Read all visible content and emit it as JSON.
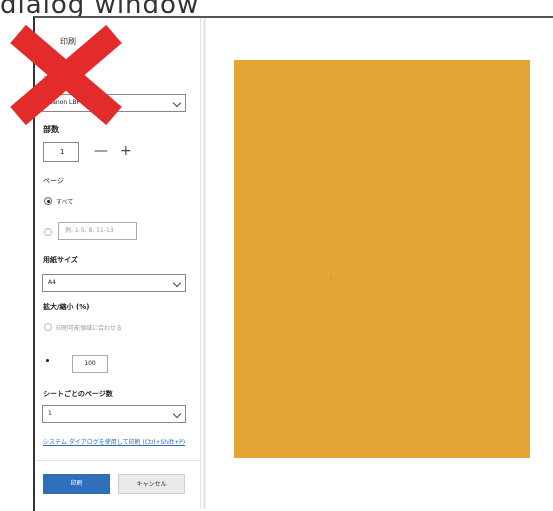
{
  "caption": "dialog window",
  "dialog": {
    "title": "印刷",
    "printer_label": "プリンター",
    "printer_value": "Canon LBP6... 018L",
    "copies_label": "部数",
    "copies_value": "1",
    "minus_icon": "minus-icon",
    "plus_icon": "plus-icon",
    "pages_label": "ページ",
    "pages_all": "すべて",
    "pages_range_placeholder": "例: 1-5, 8, 11-13",
    "paper_size_label": "用紙サイズ",
    "paper_size_value": "A4",
    "scale_label": "拡大/縮小 (%)",
    "scale_fit": "印刷可能領域に合わせる",
    "scale_value": "100",
    "pages_per_sheet_label": "シートごとのページ数",
    "pages_per_sheet_value": "1",
    "system_dialog_link": "システム ダイアログを使用して印刷 (Ctrl+Shift+P)",
    "print_button": "印刷",
    "cancel_button": "キャンセル"
  },
  "preview": {
    "page_color": "#e5a534"
  },
  "colors": {
    "accent": "#2f6fba",
    "cross": "#e32b2b"
  }
}
